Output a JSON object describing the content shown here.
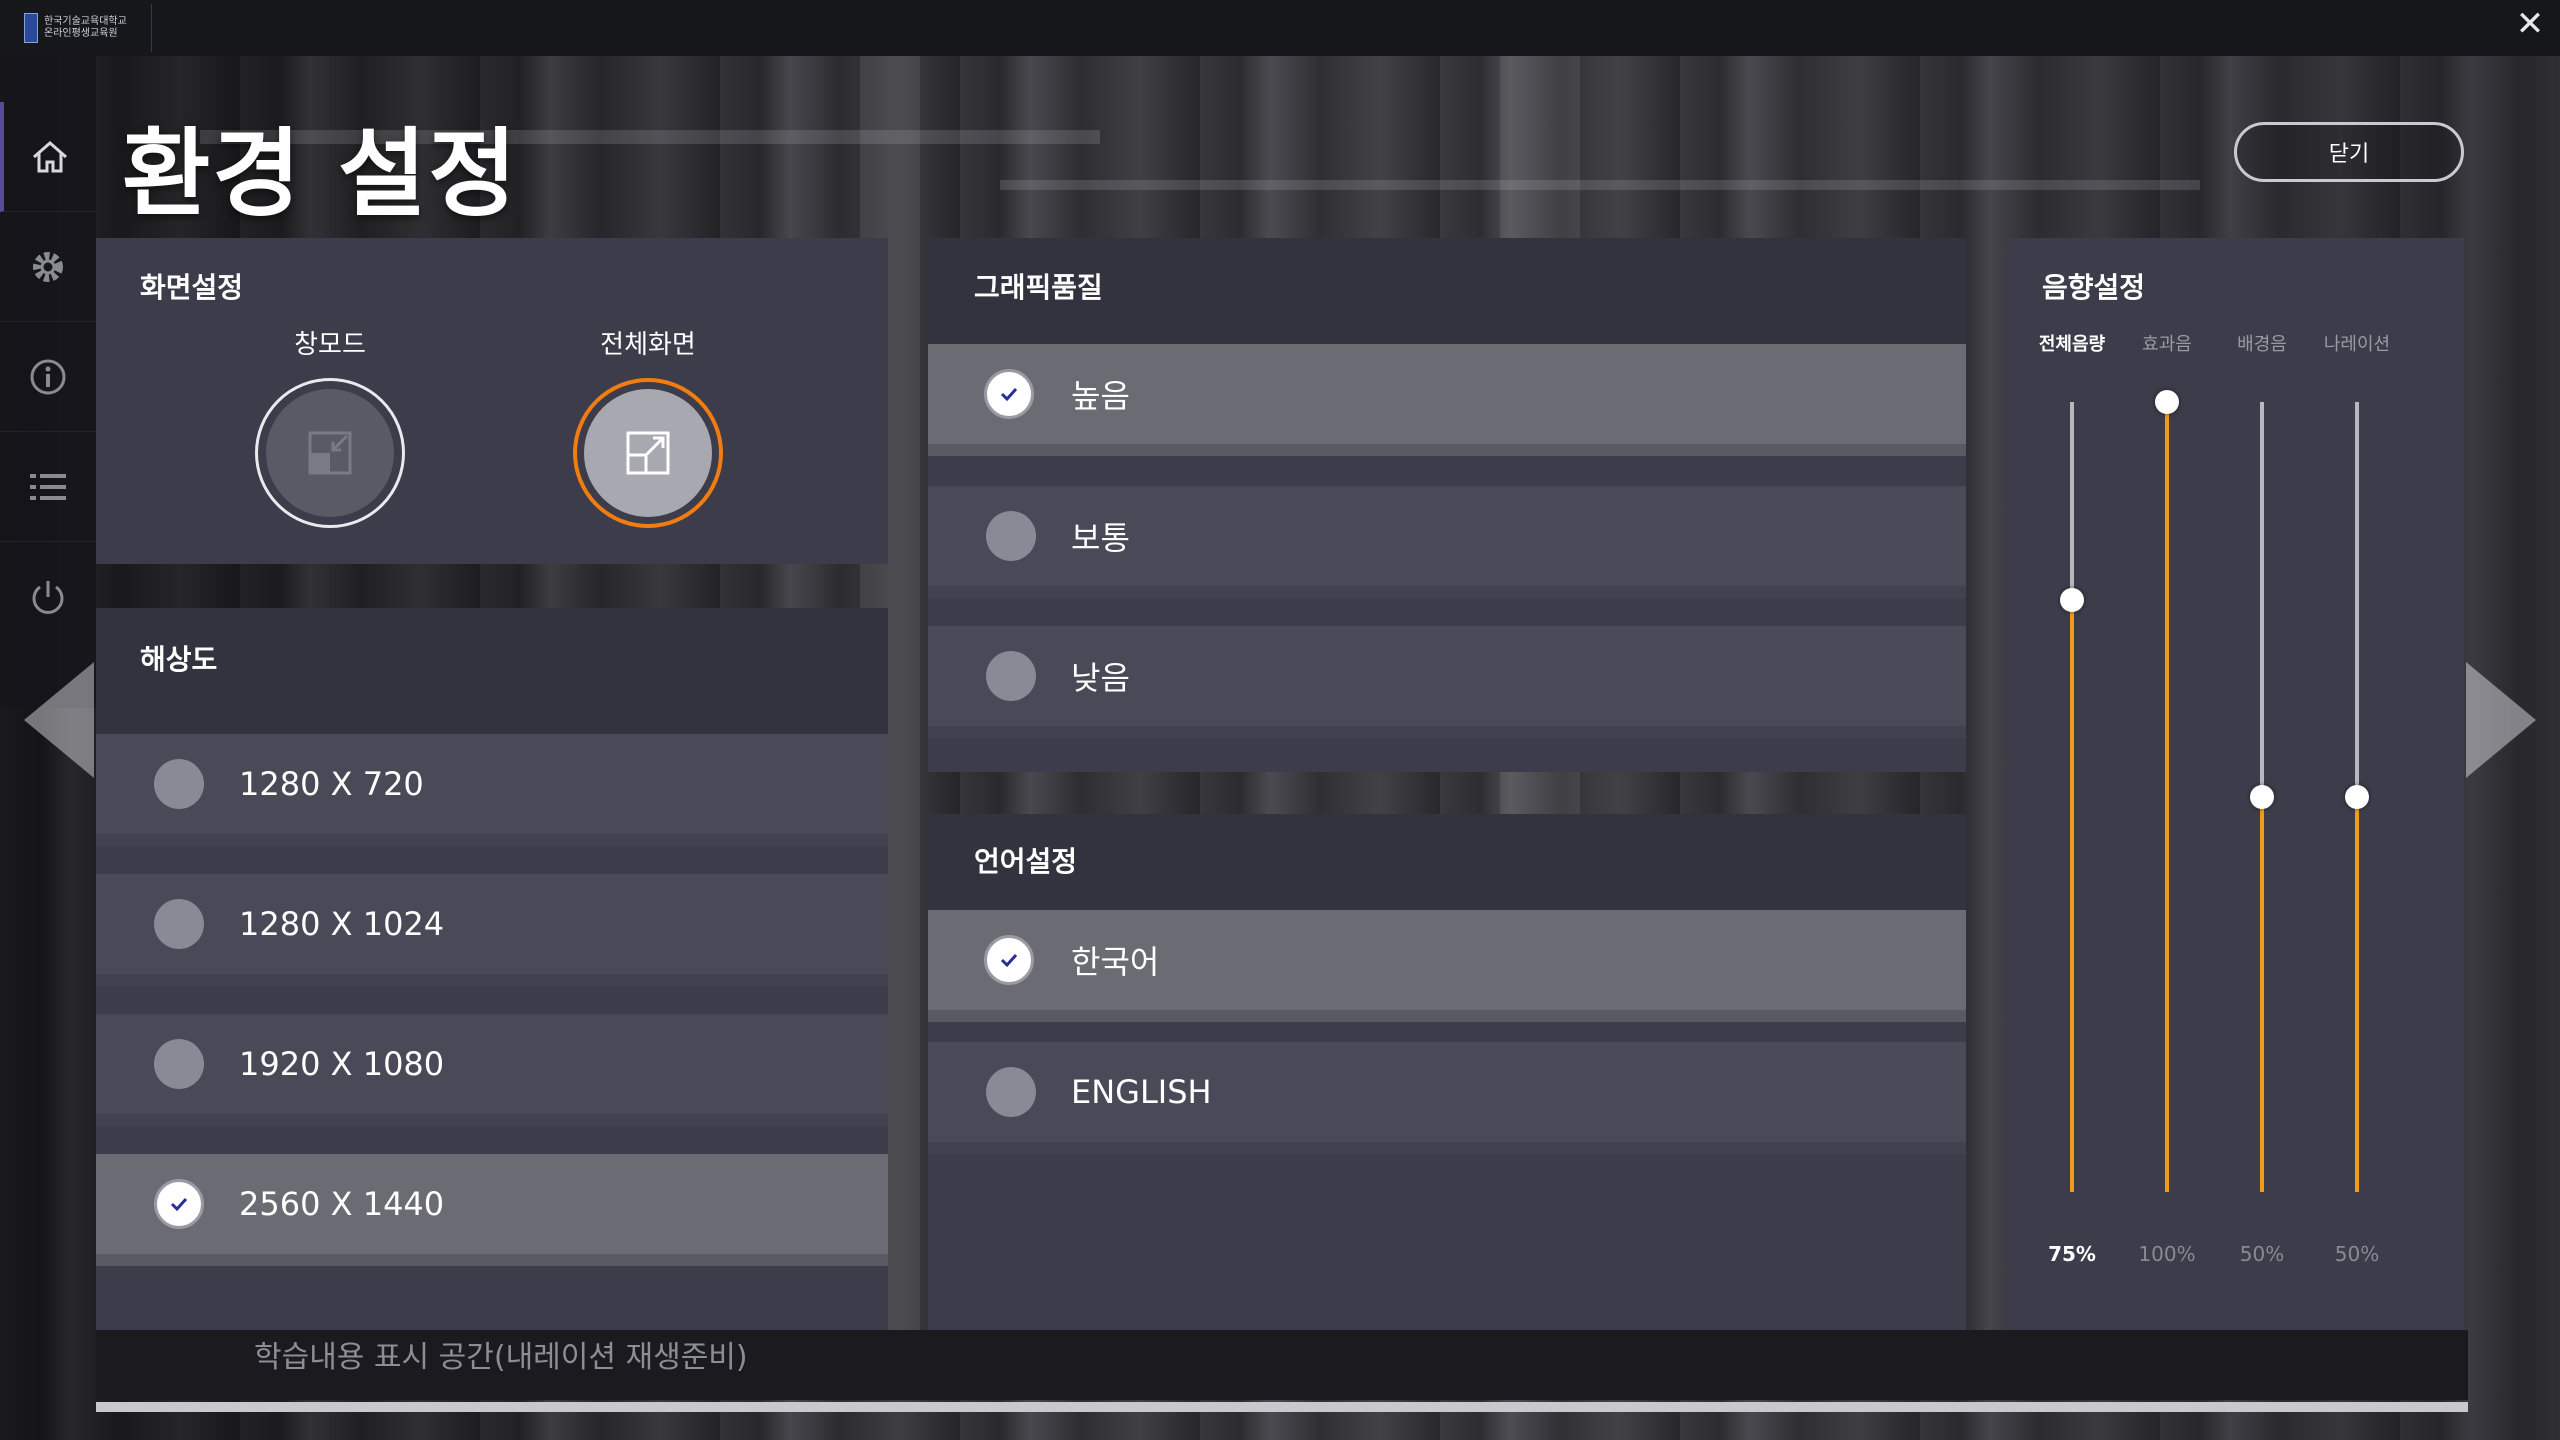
{
  "topbar": {
    "logo_line1": "한국기술교육대학교",
    "logo_line2": "온라인평생교육원",
    "close_icon": "close-icon"
  },
  "sidebar": {
    "items": [
      {
        "icon": "home-icon"
      },
      {
        "icon": "gear-icon"
      },
      {
        "icon": "info-icon"
      },
      {
        "icon": "list-icon"
      },
      {
        "icon": "power-icon"
      }
    ]
  },
  "page": {
    "title": "환경 설정",
    "close_button": "닫기"
  },
  "screen": {
    "header": "화면설정",
    "window_mode": "창모드",
    "fullscreen": "전체화면",
    "selected": "fullscreen"
  },
  "resolution": {
    "header": "해상도",
    "options": [
      "1280 X 720",
      "1280 X 1024",
      "1920 X 1080",
      "2560 X 1440"
    ],
    "selected_index": 3
  },
  "graphics": {
    "header": "그래픽품질",
    "options": [
      "높음",
      "보통",
      "낮음"
    ],
    "selected_index": 0
  },
  "language": {
    "header": "언어설정",
    "options": [
      "한국어",
      "ENGLISH"
    ],
    "selected_index": 0
  },
  "sound": {
    "header": "음향설정",
    "channels": [
      {
        "label": "전체음량",
        "value": 75,
        "display": "75%",
        "active": true
      },
      {
        "label": "효과음",
        "value": 100,
        "display": "100%",
        "active": false
      },
      {
        "label": "배경음",
        "value": 50,
        "display": "50%",
        "active": false
      },
      {
        "label": "나레이션",
        "value": 50,
        "display": "50%",
        "active": false
      }
    ]
  },
  "footer": {
    "text": "학습내용 표시 공간(내레이션 재생준비)"
  },
  "colors": {
    "accent": "#f29a1c",
    "check": "#2b2d9a",
    "panel": "#3c3c4a",
    "row": "#494957",
    "row_selected": "#6b6b74"
  }
}
